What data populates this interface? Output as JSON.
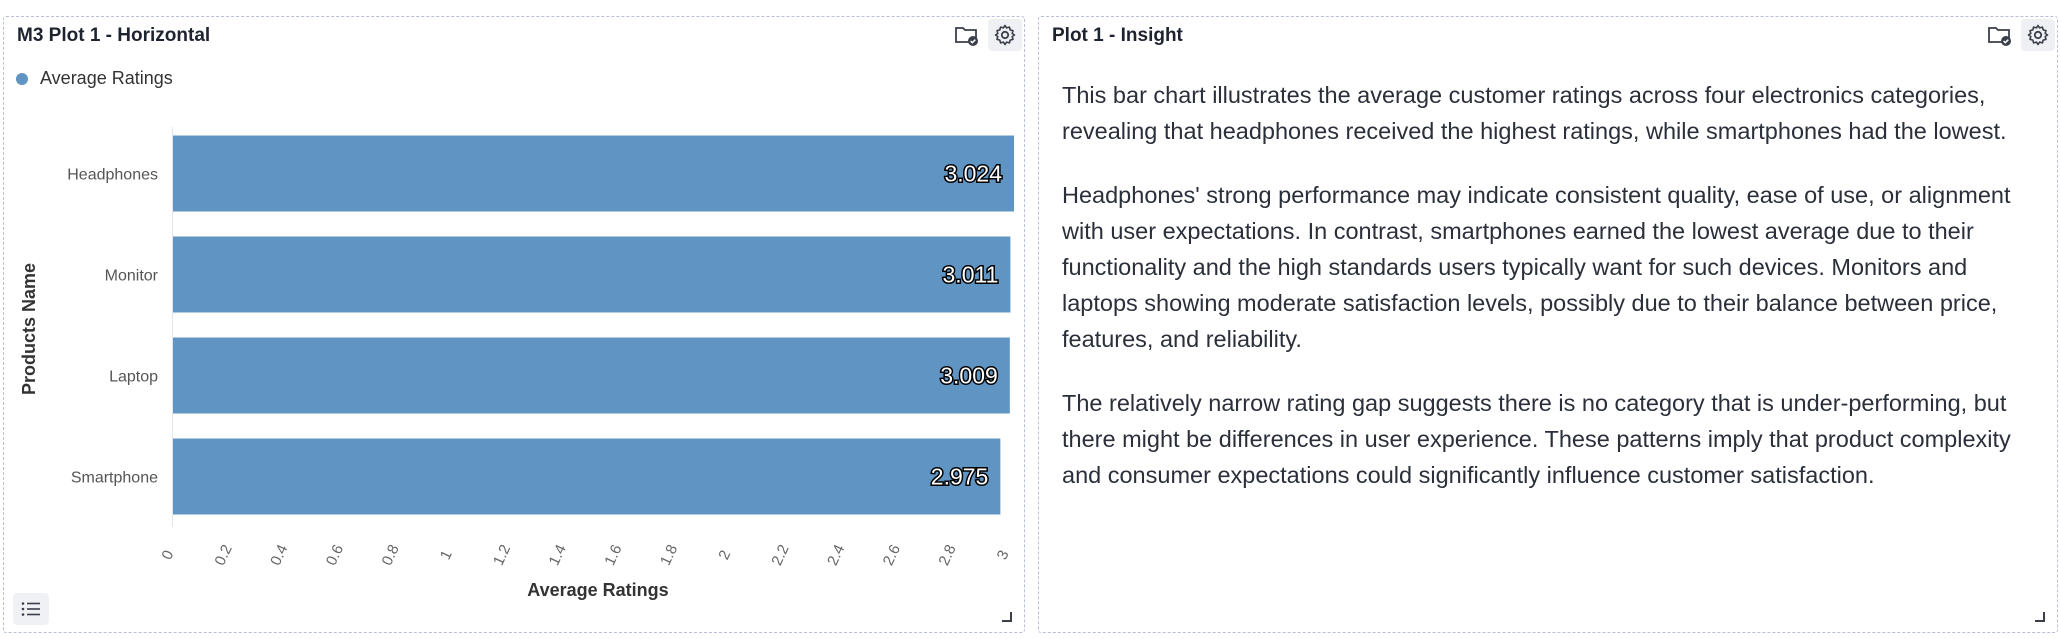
{
  "left_panel": {
    "title": "M3 Plot 1 - Horizontal",
    "legend_label": "Average Ratings"
  },
  "right_panel": {
    "title": "Plot 1 - Insight",
    "paragraphs": [
      "This bar chart illustrates the average customer ratings across four electronics categories, revealing that headphones received the highest ratings, while smartphones had the lowest.",
      "Headphones' strong performance may indicate consistent quality, ease of use, or alignment with user expectations. In contrast, smartphones earned the lowest average due to their functionality and the high standards users typically want for such devices. Monitors and laptops showing moderate satisfaction levels, possibly due to their balance between price, features, and reliability.",
      "The relatively narrow rating gap suggests there is no category that is under-performing, but there might be differences in user experience. These patterns imply that product complexity and consumer expectations could significantly influence customer satisfaction."
    ]
  },
  "icons": {
    "save": "folder-check-icon",
    "settings": "gear-icon",
    "list": "list-icon",
    "resize": "resize-corner-icon"
  },
  "colors": {
    "bar": "#6094c3",
    "border": "#b9bfd6"
  },
  "chart_data": {
    "type": "bar",
    "orientation": "horizontal",
    "categories": [
      "Headphones",
      "Monitor",
      "Laptop",
      "Smartphone"
    ],
    "series": [
      {
        "name": "Average Ratings",
        "values": [
          3.024,
          3.011,
          3.009,
          2.975
        ]
      }
    ],
    "data_labels": [
      "3.024",
      "3.011",
      "3.009",
      "2.975"
    ],
    "xlabel": "Average Ratings",
    "ylabel": "Products Name",
    "xlim": [
      0,
      3.024
    ],
    "x_ticks": [
      "0",
      "0.2",
      "0.4",
      "0.6",
      "0.8",
      "1",
      "1.2",
      "1.4",
      "1.6",
      "1.8",
      "2",
      "2.2",
      "2.4",
      "2.6",
      "2.8",
      "3"
    ],
    "grid": false,
    "legend_position": "top-left"
  }
}
